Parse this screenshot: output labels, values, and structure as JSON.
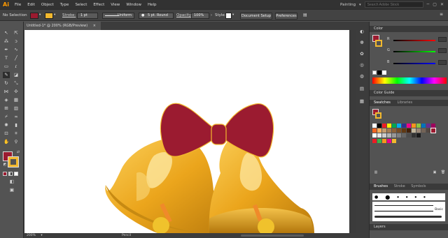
{
  "app": {
    "logo": "Ai",
    "menu": [
      "File",
      "Edit",
      "Object",
      "Type",
      "Select",
      "Effect",
      "View",
      "Window",
      "Help"
    ],
    "workspace": "Painting",
    "search_placeholder": "Search Adobe Stock"
  },
  "control": {
    "selection": "No Selection",
    "stroke_label": "Stroke:",
    "stroke_weight": "1 pt",
    "profile": "Uniform",
    "brush": "5 pt. Round",
    "opacity_label": "Opacity:",
    "opacity": "100%",
    "style_label": "Style:",
    "doc_setup": "Document Setup",
    "preferences": "Preferences"
  },
  "document": {
    "tab_title": "Untitled-1* @ 200% (RGB/Preview)",
    "close": "×"
  },
  "status": {
    "zoom": "200%",
    "tool": "Pencil"
  },
  "panels": {
    "color": "Color",
    "color_guide": "Color Guide",
    "swatches": "Swatches",
    "libraries": "Libraries",
    "brushes": "Brushes",
    "stroke": "Stroke",
    "symbols": "Symbols",
    "layers": "Layers",
    "basic": "Basic",
    "r": "R",
    "g": "G",
    "b": "B"
  },
  "colors": {
    "fill": "#9b1b30",
    "stroke": "#f2b82e",
    "accent": "#ff9a00"
  }
}
